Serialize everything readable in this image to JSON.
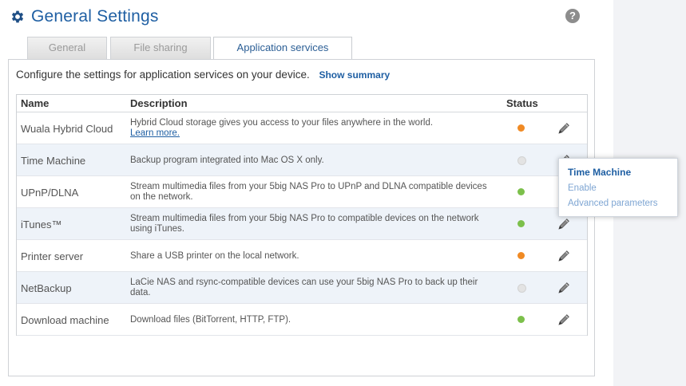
{
  "header": {
    "title": "General Settings",
    "help": "?"
  },
  "tabs": [
    {
      "label": "General",
      "active": false
    },
    {
      "label": "File sharing",
      "active": false
    },
    {
      "label": "Application services",
      "active": true
    }
  ],
  "intro": {
    "text": "Configure the settings for application services on your device.",
    "summary_link": "Show summary"
  },
  "table": {
    "columns": {
      "name": "Name",
      "description": "Description",
      "status": "Status"
    },
    "rows": [
      {
        "name": "Wuala Hybrid Cloud",
        "description": "Hybrid Cloud storage gives you access to your files anywhere in the world.",
        "link": "Learn more.",
        "status": "orange"
      },
      {
        "name": "Time Machine",
        "description": "Backup program integrated into Mac OS X only.",
        "link": "",
        "status": "off"
      },
      {
        "name": "UPnP/DLNA",
        "description": "Stream multimedia files from your 5big NAS Pro to UPnP and DLNA compatible devices on the network.",
        "link": "",
        "status": "green"
      },
      {
        "name": "iTunes™",
        "description": "Stream multimedia files from your 5big NAS Pro to compatible devices on the network using iTunes.",
        "link": "",
        "status": "green"
      },
      {
        "name": "Printer server",
        "description": "Share a USB printer on the local network.",
        "link": "",
        "status": "orange"
      },
      {
        "name": "NetBackup",
        "description": "LaCie NAS and rsync-compatible devices can use your 5big NAS Pro to back up their data.",
        "link": "",
        "status": "off"
      },
      {
        "name": "Download machine",
        "description": "Download files (BitTorrent, HTTP, FTP).",
        "link": "",
        "status": "green"
      }
    ]
  },
  "popup": {
    "title": "Time Machine",
    "items": [
      "Enable",
      "Advanced parameters"
    ]
  },
  "colors": {
    "accent": "#1f5fa3",
    "status_green": "#7cc04b",
    "status_orange": "#f08a24",
    "status_off": "#e3e3e3"
  },
  "icons": {
    "header": "gear-icon",
    "edit": "pencil-icon",
    "help": "help-icon"
  }
}
